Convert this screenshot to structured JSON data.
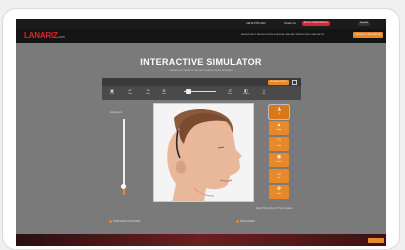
{
  "topbar": {
    "links": [
      "Call 914 555 0100",
      "Contact Us"
    ],
    "pill_red": "BOOK CONSULTATION",
    "pill_dark": "Español"
  },
  "navbar": {
    "logo_main": "LANARIZ",
    "logo_suffix": ".com",
    "links": "RHINOPLASTY  REVISION  NON-SURGICAL  GALLERY  PATIENT INFO  SIMULATOR",
    "cta": "VIRTUAL CONSULTATION"
  },
  "hero": {
    "title": "INTERACTIVE SIMULATOR",
    "subtitle": "Upload your photo or use our model to try the simulator"
  },
  "toolbar": {
    "upload_label": "UPLOAD PHOTO",
    "tools": [
      {
        "icon": "image-icon",
        "glyph": "▣",
        "label": "Photo"
      },
      {
        "icon": "undo-icon",
        "glyph": "↶",
        "label": "Undo"
      },
      {
        "icon": "redo-icon",
        "glyph": "↷",
        "label": "Redo"
      },
      {
        "icon": "zoom-icon",
        "glyph": "⊕",
        "label": "Zoom"
      },
      {
        "icon": "reset-icon",
        "glyph": "↺",
        "label": "Reset"
      },
      {
        "icon": "compare-icon",
        "glyph": "◧",
        "label": "Compare"
      },
      {
        "icon": "save-icon",
        "glyph": "⇩",
        "label": "Save"
      }
    ]
  },
  "slider": {
    "label": "Adjustment",
    "level": 0.13
  },
  "ribbon": [
    {
      "icon": "nose-tip-icon",
      "glyph": "◮",
      "label": "Tip"
    },
    {
      "icon": "bridge-icon",
      "glyph": "▲",
      "label": "Bridge"
    },
    {
      "icon": "hump-icon",
      "glyph": "◠",
      "label": "Hump"
    },
    {
      "icon": "nostril-icon",
      "glyph": "◉",
      "label": "Nostril"
    },
    {
      "icon": "chin-icon",
      "glyph": "◡",
      "label": "Chin"
    },
    {
      "icon": "move-icon",
      "glyph": "✥",
      "label": "Move"
    }
  ],
  "caption": "Side Profile  |  Front  |  Three Quarter",
  "footer": {
    "left": "HOW DOES THIS WORK",
    "right": "DISCLAIMER"
  },
  "colors": {
    "accent": "#e58a2b",
    "brand_red": "#d9272e",
    "background": "#7a7a7a"
  }
}
